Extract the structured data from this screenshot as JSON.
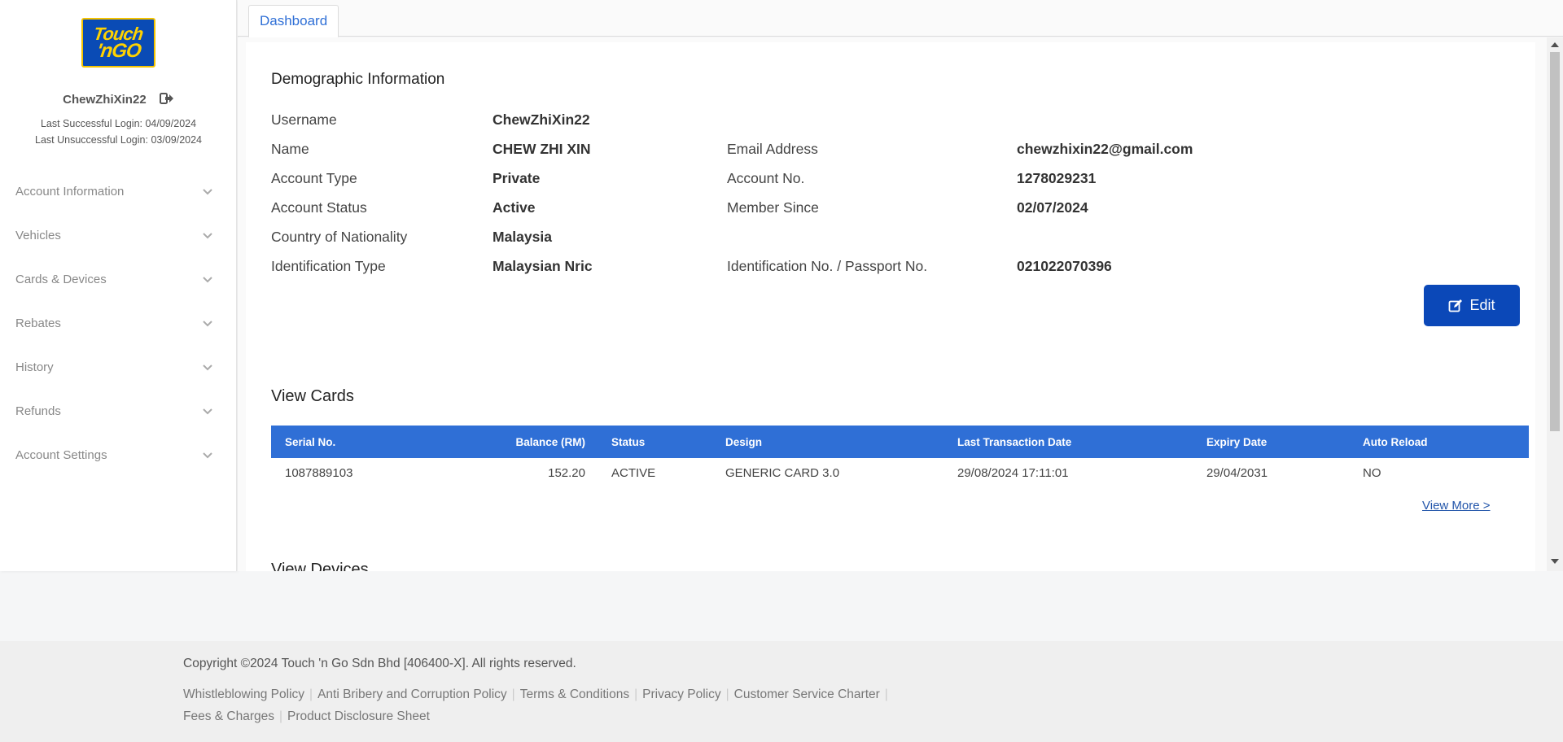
{
  "logo": {
    "line1": "Touch",
    "line2": "'nGO"
  },
  "user": {
    "username": "ChewZhiXin22",
    "last_success": "Last Successful Login: 04/09/2024",
    "last_unsuccess": "Last Unsuccessful Login: 03/09/2024"
  },
  "sidebar": {
    "items": [
      {
        "label": "Account Information"
      },
      {
        "label": "Vehicles"
      },
      {
        "label": "Cards & Devices"
      },
      {
        "label": "Rebates"
      },
      {
        "label": "History"
      },
      {
        "label": "Refunds"
      },
      {
        "label": "Account Settings"
      }
    ]
  },
  "tabs": [
    {
      "label": "Dashboard"
    }
  ],
  "demographic": {
    "title": "Demographic Information",
    "username_label": "Username",
    "username": "ChewZhiXin22",
    "name_label": "Name",
    "name": "CHEW ZHI XIN",
    "email_label": "Email Address",
    "email": "chewzhixin22@gmail.com",
    "type_label": "Account Type",
    "type": "Private",
    "acctno_label": "Account No.",
    "acctno": "1278029231",
    "status_label": "Account Status",
    "status": "Active",
    "member_label": "Member Since",
    "member": "02/07/2024",
    "country_label": "Country of Nationality",
    "country": "Malaysia",
    "idtype_label": "Identification Type",
    "idtype": "Malaysian Nric",
    "idno_label": "Identification No. / Passport No.",
    "idno": "021022070396",
    "edit_label": "Edit"
  },
  "cards": {
    "title": "View Cards",
    "headers": [
      "Serial No.",
      "Balance (RM)",
      "Status",
      "Design",
      "Last Transaction Date",
      "Expiry Date",
      "Auto Reload"
    ],
    "rows": [
      [
        "1087889103",
        "152.20",
        "ACTIVE",
        "GENERIC CARD 3.0",
        "29/08/2024 17:11:01",
        "29/04/2031",
        "NO"
      ]
    ],
    "view_more": "View More >"
  },
  "devices": {
    "title": "View Devices"
  },
  "footer": {
    "copyright": "Copyright ©2024 Touch 'n Go Sdn Bhd [406400-X]. All rights reserved.",
    "links": [
      "Whistleblowing Policy",
      "Anti Bribery and Corruption Policy",
      "Terms & Conditions",
      "Privacy Policy",
      "Customer Service Charter",
      "Fees & Charges",
      "Product Disclosure Sheet"
    ]
  },
  "colors": {
    "primary": "#2f6fd6",
    "button": "#0b48b8",
    "logo_bg": "#0a4bb5",
    "logo_text": "#ffd200"
  }
}
